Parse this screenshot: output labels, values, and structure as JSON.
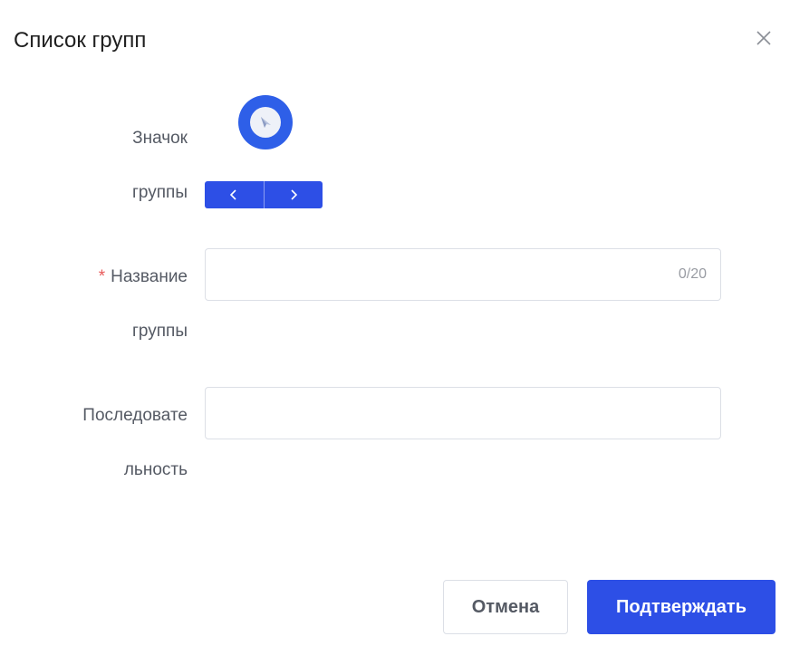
{
  "dialog": {
    "title": "Список групп",
    "close_icon": "close-icon"
  },
  "form": {
    "icon_field": {
      "label_line1": "Значок",
      "label_line2": "группы",
      "icon": "compass-icon",
      "icon_color": "#2e5fe8",
      "prev_icon": "chevron-left-icon",
      "next_icon": "chevron-right-icon"
    },
    "name_field": {
      "required_mark": "*",
      "label_line1": "Название",
      "label_line2": "группы",
      "value": "",
      "counter": "0/20"
    },
    "order_field": {
      "label_line1": "Последовате",
      "label_line2": "льность",
      "value": ""
    }
  },
  "footer": {
    "cancel_label": "Отмена",
    "confirm_label": "Подтверждать"
  },
  "colors": {
    "primary": "#2d4fe6",
    "required": "#e85b5b",
    "label": "#555a64"
  }
}
